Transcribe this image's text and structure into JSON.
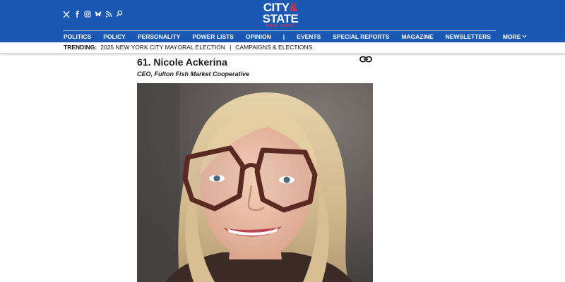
{
  "header": {
    "logo": {
      "line1_a": "CITY",
      "line1_amp": "&",
      "line2": "STATE",
      "line3": "NEW YORK"
    },
    "social_icons": [
      "x-icon",
      "facebook-icon",
      "instagram-icon",
      "bluesky-icon",
      "rss-icon",
      "search-icon"
    ],
    "brand_color": "#1b58b4",
    "accent_color": "#e8322f"
  },
  "nav": {
    "items": [
      "POLITICS",
      "POLICY",
      "PERSONALITY",
      "POWER LISTS",
      "OPINION"
    ],
    "separator": "|",
    "items2": [
      "EVENTS",
      "SPECIAL REPORTS",
      "MAGAZINE",
      "NEWSLETTERS"
    ],
    "more": "MORE"
  },
  "trending": {
    "label": "TRENDING:",
    "links": [
      "2025 NEW YORK CITY MAYORAL ELECTION",
      "CAMPAIGNS & ELECTIONS"
    ],
    "separator": "|"
  },
  "article": {
    "title": "61. Nicole Ackerina",
    "subtitle": "CEO, Fulton Fish Market Cooperative"
  }
}
